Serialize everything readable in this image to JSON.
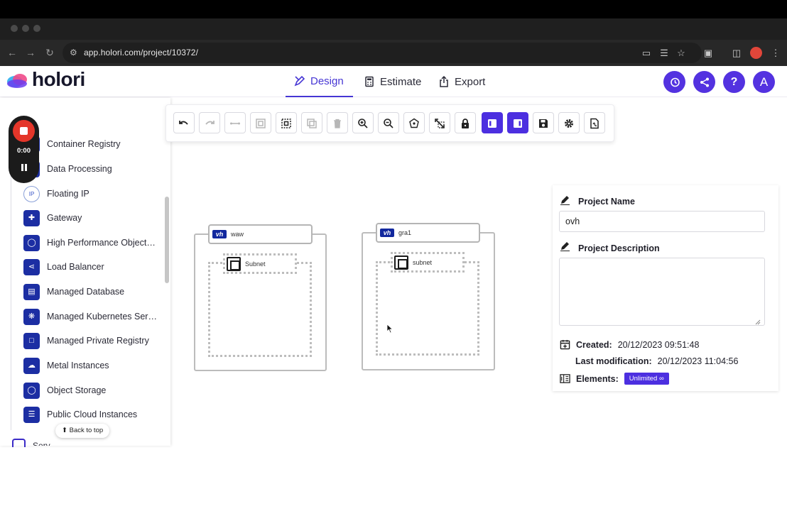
{
  "browser": {
    "url": "app.holori.com/project/10372/"
  },
  "app": {
    "logo_text": "holori",
    "nav": [
      {
        "label": "Design",
        "icon": "pencil-ruler-icon",
        "active": true
      },
      {
        "label": "Estimate",
        "icon": "calculator-icon",
        "active": false
      },
      {
        "label": "Export",
        "icon": "export-icon",
        "active": false
      }
    ],
    "header_buttons": [
      "history-icon",
      "share-icon",
      "help-icon"
    ],
    "avatar_letter": "A",
    "accent_color": "#5332e0"
  },
  "recorder": {
    "time": "0:00"
  },
  "toolbar": {
    "buttons": [
      {
        "name": "undo",
        "state": "enabled"
      },
      {
        "name": "redo",
        "state": "disabled"
      },
      {
        "name": "connect",
        "state": "disabled"
      },
      {
        "name": "group",
        "state": "disabled"
      },
      {
        "name": "select-area",
        "state": "enabled"
      },
      {
        "name": "duplicate",
        "state": "disabled"
      },
      {
        "name": "delete",
        "state": "disabled"
      },
      {
        "name": "zoom-in",
        "state": "enabled"
      },
      {
        "name": "zoom-out",
        "state": "enabled"
      },
      {
        "name": "center",
        "state": "enabled"
      },
      {
        "name": "fit-screen",
        "state": "enabled"
      },
      {
        "name": "lock",
        "state": "enabled"
      },
      {
        "name": "left-panel-toggle",
        "state": "active"
      },
      {
        "name": "right-panel-toggle",
        "state": "active"
      },
      {
        "name": "save",
        "state": "enabled"
      },
      {
        "name": "settings",
        "state": "enabled"
      },
      {
        "name": "export-pdf",
        "state": "enabled"
      }
    ]
  },
  "sidebar": {
    "items": [
      {
        "label": "Container Registry"
      },
      {
        "label": "Data Processing"
      },
      {
        "label": "Floating IP",
        "badge": "IP"
      },
      {
        "label": "Gateway"
      },
      {
        "label": "High Performance Object Storage"
      },
      {
        "label": "Load Balancer"
      },
      {
        "label": "Managed Database"
      },
      {
        "label": "Managed Kubernetes Service"
      },
      {
        "label": "Managed Private Registry"
      },
      {
        "label": "Metal Instances"
      },
      {
        "label": "Object Storage"
      },
      {
        "label": "Public Cloud Instances"
      }
    ],
    "back_to_top": "Back to top",
    "partial_next_label": "Serv"
  },
  "canvas": {
    "regions": [
      {
        "label": "waw",
        "subnet_label": "Subnet"
      },
      {
        "label": "gra1",
        "subnet_label": "subnet"
      }
    ]
  },
  "properties": {
    "project_name_label": "Project Name",
    "project_name_value": "ovh",
    "project_description_label": "Project Description",
    "project_description_value": "",
    "created_label": "Created:",
    "created_value": "20/12/2023 09:51:48",
    "modified_label": "Last modification:",
    "modified_value": "20/12/2023 11:04:56",
    "elements_label": "Elements:",
    "elements_value": "Unlimited ∞"
  }
}
